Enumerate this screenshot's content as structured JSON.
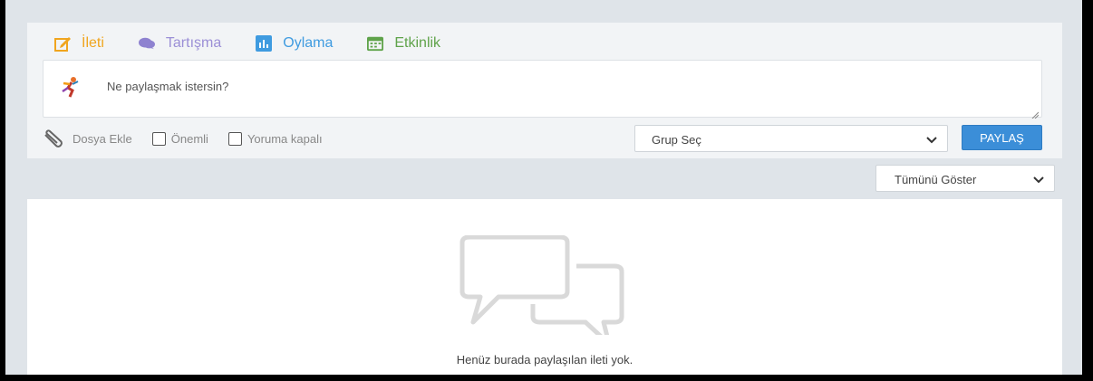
{
  "tabs": [
    {
      "label": "İleti",
      "icon": "edit-icon",
      "color": "#f0a51e",
      "active": true
    },
    {
      "label": "Tartışma",
      "icon": "chat-bubbles-icon",
      "color": "#9b8fd6"
    },
    {
      "label": "Oylama",
      "icon": "bar-chart-icon",
      "color": "#3f9be0"
    },
    {
      "label": "Etkinlik",
      "icon": "calendar-icon",
      "color": "#5fa34a"
    }
  ],
  "composer": {
    "placeholder": "Ne paylaşmak istersin?",
    "attach_label": "Dosya Ekle",
    "important_label": "Önemli",
    "comments_closed_label": "Yoruma kapalı",
    "group_select_value": "Grup Seç",
    "share_label": "PAYLAŞ"
  },
  "filter": {
    "value": "Tümünü Göster"
  },
  "feed": {
    "empty_message": "Henüz burada paylaşılan ileti yok."
  },
  "colors": {
    "accent": "#3b8ed8",
    "background": "#dfe4e9"
  }
}
